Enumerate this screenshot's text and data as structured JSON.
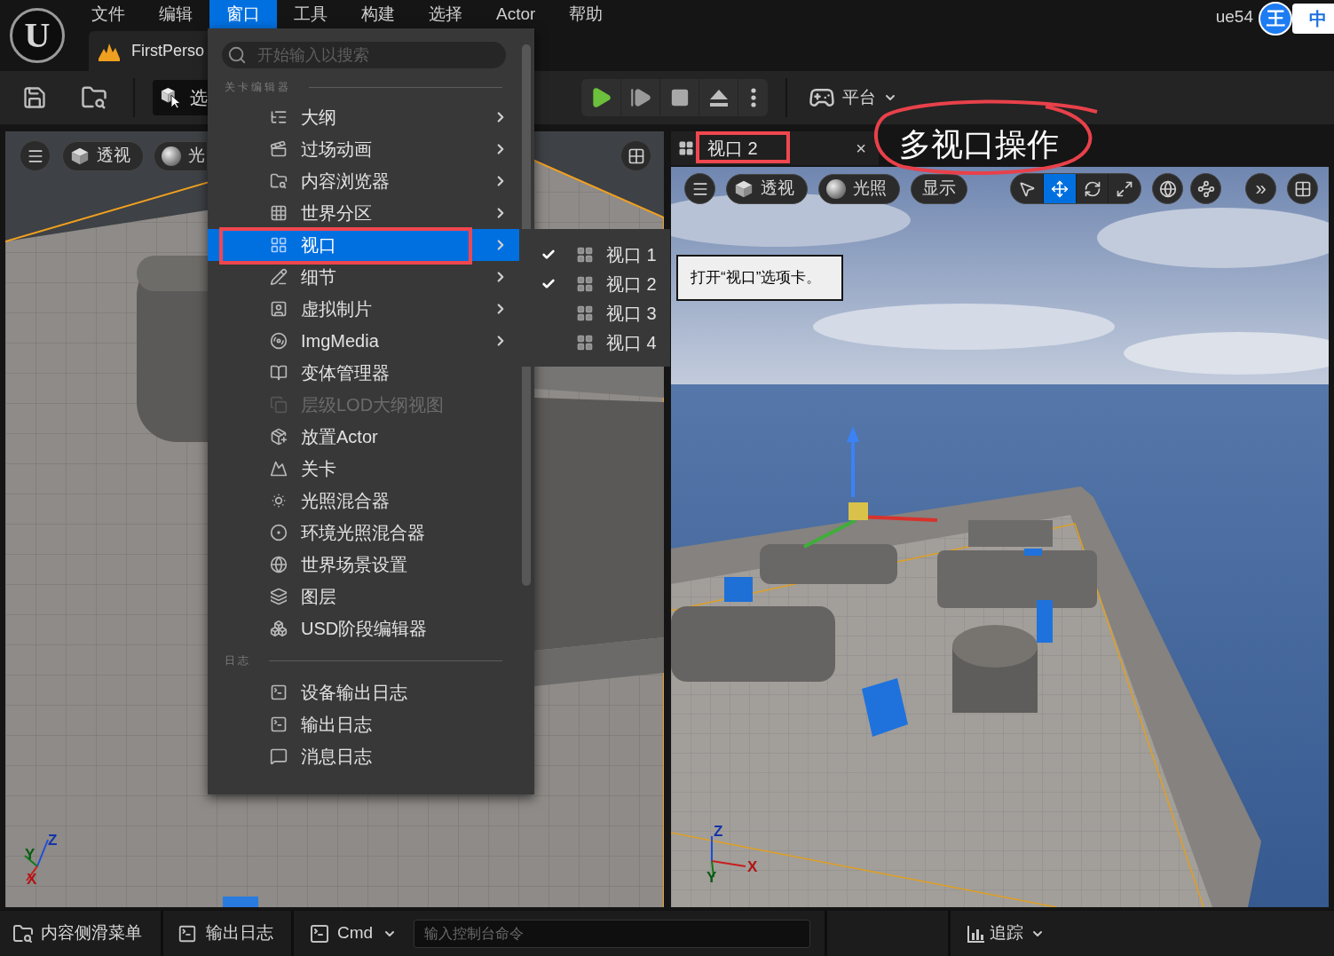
{
  "app": {
    "logo_text": "U"
  },
  "menu_bar": {
    "items": [
      {
        "label": "文件",
        "selected": false
      },
      {
        "label": "编辑",
        "selected": false
      },
      {
        "label": "窗口",
        "selected": true
      },
      {
        "label": "工具",
        "selected": false
      },
      {
        "label": "构建",
        "selected": false
      },
      {
        "label": "选择",
        "selected": false
      },
      {
        "label": "Actor",
        "selected": false
      },
      {
        "label": "帮助",
        "selected": false
      }
    ],
    "project": "ue54"
  },
  "ime_badge": {
    "logo_text": "王",
    "mode": "中"
  },
  "document_tab": {
    "label": "FirstPerso"
  },
  "toolbar": {
    "mode_button": {
      "label": "选"
    },
    "platform_button": {
      "label": "平台"
    }
  },
  "left_viewport": {
    "view_button": {
      "label": "透视"
    },
    "lighting_button": {
      "label": "光"
    },
    "axes": {
      "z": "Z",
      "y": "Y",
      "x": "X"
    }
  },
  "right_viewport": {
    "tab": {
      "label": "视口 2",
      "close": "×"
    },
    "view_button": {
      "label": "透视"
    },
    "lighting_button": {
      "label": "光照"
    },
    "show_button": {
      "label": "显示"
    },
    "tools": [
      {
        "kind": "select",
        "selected": false
      },
      {
        "kind": "move",
        "selected": true
      },
      {
        "kind": "rotate",
        "selected": false
      },
      {
        "kind": "scale",
        "selected": false
      }
    ],
    "more_button": {
      "label": "»"
    },
    "axes": {
      "z": "Z",
      "y": "Y",
      "x": "X"
    }
  },
  "annotation": {
    "text": "多视口操作"
  },
  "window_menu": {
    "search": {
      "placeholder": "开始输入以搜索"
    },
    "sections": [
      {
        "title": "关卡编辑器",
        "items": [
          {
            "label": "大纲",
            "kind": "outline",
            "submenu": true,
            "selected": false,
            "disabled": false
          },
          {
            "label": "过场动画",
            "kind": "cinematics",
            "submenu": true,
            "selected": false,
            "disabled": false
          },
          {
            "label": "内容浏览器",
            "kind": "content",
            "submenu": true,
            "selected": false,
            "disabled": false
          },
          {
            "label": "世界分区",
            "kind": "partition",
            "submenu": true,
            "selected": false,
            "disabled": false
          },
          {
            "label": "视口",
            "kind": "viewport",
            "submenu": true,
            "selected": true,
            "disabled": false
          },
          {
            "label": "细节",
            "kind": "details",
            "submenu": true,
            "selected": false,
            "disabled": false
          },
          {
            "label": "虚拟制片",
            "kind": "virtual",
            "submenu": true,
            "selected": false,
            "disabled": false
          },
          {
            "label": "ImgMedia",
            "kind": "media",
            "submenu": true,
            "selected": false,
            "disabled": false
          },
          {
            "label": "变体管理器",
            "kind": "variants",
            "submenu": false,
            "selected": false,
            "disabled": false
          },
          {
            "label": "层级LOD大纲视图",
            "kind": "hlod",
            "submenu": false,
            "selected": false,
            "disabled": true
          },
          {
            "label": "放置Actor",
            "kind": "place",
            "submenu": false,
            "selected": false,
            "disabled": false
          },
          {
            "label": "关卡",
            "kind": "level",
            "submenu": false,
            "selected": false,
            "disabled": false
          },
          {
            "label": "光照混合器",
            "kind": "lightmix",
            "submenu": false,
            "selected": false,
            "disabled": false
          },
          {
            "label": "环境光照混合器",
            "kind": "envmix",
            "submenu": false,
            "selected": false,
            "disabled": false
          },
          {
            "label": "世界场景设置",
            "kind": "world",
            "submenu": false,
            "selected": false,
            "disabled": false
          },
          {
            "label": "图层",
            "kind": "layers",
            "submenu": false,
            "selected": false,
            "disabled": false
          },
          {
            "label": "USD阶段编辑器",
            "kind": "usd",
            "submenu": false,
            "selected": false,
            "disabled": false
          }
        ]
      },
      {
        "title": "日志",
        "items": [
          {
            "label": "设备输出日志",
            "kind": "terminal",
            "submenu": false,
            "selected": false,
            "disabled": false
          },
          {
            "label": "输出日志",
            "kind": "terminal",
            "submenu": false,
            "selected": false,
            "disabled": false
          },
          {
            "label": "消息日志",
            "kind": "message",
            "submenu": false,
            "selected": false,
            "disabled": false
          }
        ]
      }
    ]
  },
  "viewport_submenu": {
    "items": [
      {
        "label": "视口 1",
        "checked": true
      },
      {
        "label": "视口 2",
        "checked": true
      },
      {
        "label": "视口 3",
        "checked": false
      },
      {
        "label": "视口 4",
        "checked": false
      }
    ]
  },
  "tooltip": {
    "text": "打开“视口”选项卡。"
  },
  "status_bar": {
    "content_drawer": {
      "label": "内容侧滑菜单"
    },
    "output_log": {
      "label": "输出日志"
    },
    "console": {
      "label": "Cmd",
      "placeholder": "输入控制台命令"
    },
    "trace": {
      "label": "追踪"
    }
  }
}
